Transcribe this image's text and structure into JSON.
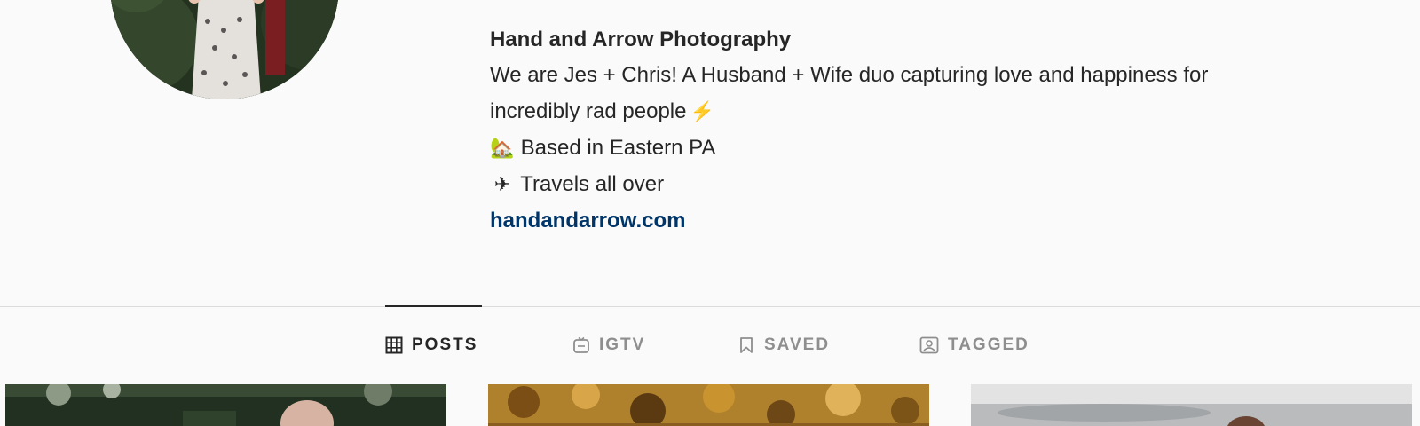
{
  "profile": {
    "full_name": "Hand and Arrow Photography",
    "bio_line_1": "We are Jes + Chris! A Husband + Wife duo capturing love and happiness for",
    "bio_line_2": "incredibly rad people",
    "bio_line_2_emoji": "⚡",
    "bio_line_3_emoji": "🏡",
    "bio_line_3": "Based in Eastern PA",
    "bio_line_4_emoji": "✈",
    "bio_line_4": "Travels all over",
    "website": "handandarrow.com"
  },
  "tabs": [
    {
      "label": "POSTS",
      "icon": "grid-icon",
      "active": true
    },
    {
      "label": "IGTV",
      "icon": "igtv-icon",
      "active": false
    },
    {
      "label": "SAVED",
      "icon": "bookmark-icon",
      "active": false
    },
    {
      "label": "TAGGED",
      "icon": "tagged-icon",
      "active": false
    }
  ],
  "posts": [
    {
      "description": "Outdoor portrait with trees"
    },
    {
      "description": "Autumn foliage"
    },
    {
      "description": "Overcast sky portrait"
    }
  ],
  "colors": {
    "background": "#fafafa",
    "text": "#262626",
    "muted": "#8e8e8e",
    "link": "#003569",
    "divider": "#dbdbdb"
  }
}
